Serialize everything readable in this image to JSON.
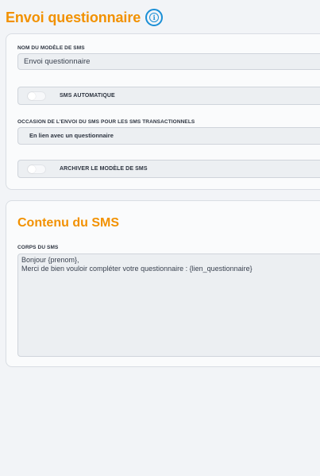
{
  "header": {
    "title": "Envoi questionnaire",
    "info_icon": "info-circle-icon"
  },
  "template_section": {
    "name_label": "NOM DU MODÈLE DE SMS",
    "name_value": "Envoi questionnaire",
    "auto_sms_label": "SMS AUTOMATIQUE",
    "auto_sms_enabled": false,
    "occasion_label": "OCCASION DE L'ENVOI DU SMS POUR LES SMS TRANSACTIONNELS",
    "occasion_value": "En lien avec un questionnaire",
    "archive_label": "ARCHIVER LE MODÈLE DE SMS",
    "archive_enabled": false
  },
  "content_section": {
    "title": "Contenu du SMS",
    "body_label": "CORPS DU SMS",
    "body_value": "Bonjour {prenom},\nMerci de bien vouloir compléter votre questionnaire : {lien_questionnaire}"
  },
  "colors": {
    "accent": "#f29100",
    "info": "#1a8fd6",
    "background": "#f2f4f7"
  }
}
